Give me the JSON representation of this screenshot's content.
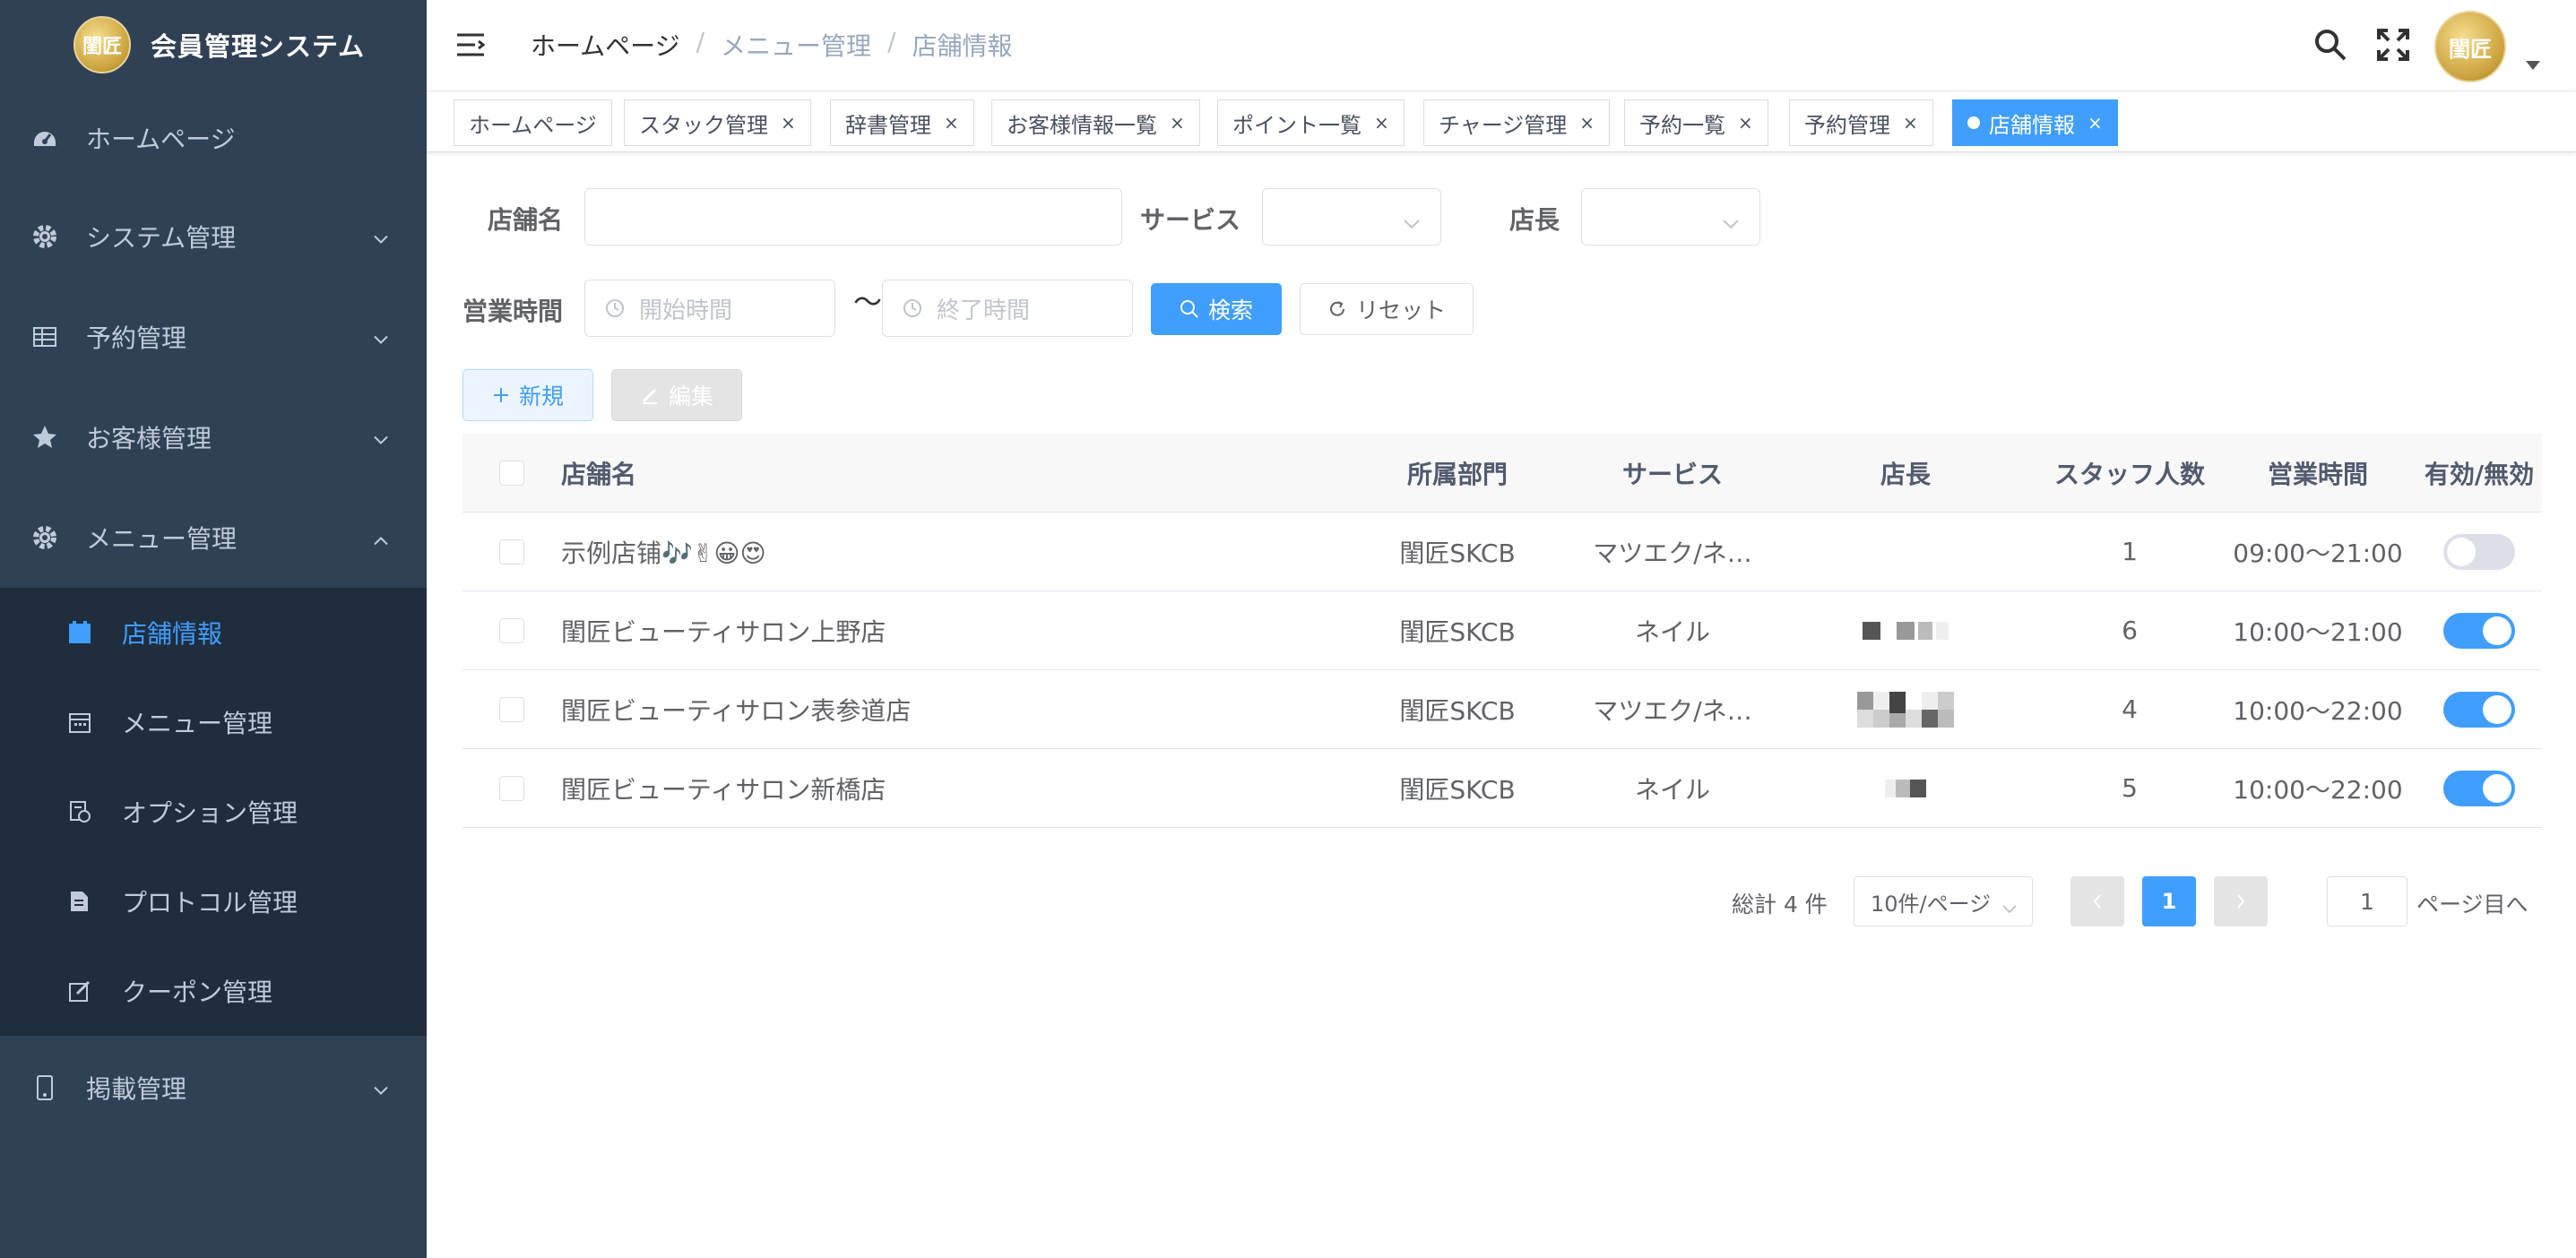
{
  "app": {
    "title": "会員管理システム",
    "logo_text": "閨匠"
  },
  "sidebar": {
    "items": [
      {
        "label": "ホームページ",
        "icon": "dashboard-icon"
      },
      {
        "label": "システム管理",
        "icon": "gear-icon"
      },
      {
        "label": "予約管理",
        "icon": "table-icon"
      },
      {
        "label": "お客様管理",
        "icon": "star-icon"
      },
      {
        "label": "メニュー管理",
        "icon": "gear-icon",
        "expanded": true
      }
    ],
    "submenu": [
      {
        "label": "店舗情報",
        "icon": "shop-icon",
        "active": true
      },
      {
        "label": "メニュー管理",
        "icon": "calendar-icon"
      },
      {
        "label": "オプション管理",
        "icon": "option-icon"
      },
      {
        "label": "プロトコル管理",
        "icon": "document-icon"
      },
      {
        "label": "クーポン管理",
        "icon": "edit-icon"
      }
    ],
    "bottom_item": {
      "label": "掲載管理",
      "icon": "phone-icon"
    }
  },
  "breadcrumb": [
    "ホームページ",
    "メニュー管理",
    "店舗情報"
  ],
  "breadcrumb_sep": "/",
  "tags": [
    {
      "label": "ホームページ",
      "closable": false
    },
    {
      "label": "スタック管理",
      "closable": true
    },
    {
      "label": "辞書管理",
      "closable": true
    },
    {
      "label": "お客様情報一覧",
      "closable": true
    },
    {
      "label": "ポイント一覧",
      "closable": true
    },
    {
      "label": "チャージ管理",
      "closable": true
    },
    {
      "label": "予約一覧",
      "closable": true
    },
    {
      "label": "予約管理",
      "closable": true
    },
    {
      "label": "店舗情報",
      "closable": true,
      "active": true
    }
  ],
  "tag_close": "×",
  "search_form": {
    "store_name_label": "店舗名",
    "store_name_value": "",
    "service_label": "サービス",
    "manager_label": "店長",
    "hours_label": "営業時間",
    "start_placeholder": "開始時間",
    "range_sep": "〜",
    "end_placeholder": "終了時間",
    "search_button": "検索",
    "reset_button": "リセット"
  },
  "toolbar": {
    "new_button": "新規",
    "edit_button": "編集"
  },
  "table": {
    "headers": [
      "店舗名",
      "所属部門",
      "サービス",
      "店長",
      "スタッフ人数",
      "営業時間",
      "有効/無効"
    ],
    "rows": [
      {
        "name": "示例店铺🎶✌😀😍",
        "dept": "閨匠SKCB",
        "service": "マツエク/ネ…",
        "manager": "",
        "staff": "1",
        "hours": "09:00〜21:00",
        "enabled": false
      },
      {
        "name": "閨匠ビューティサロン上野店",
        "dept": "閨匠SKCB",
        "service": "ネイル",
        "manager": "",
        "staff": "6",
        "hours": "10:00〜21:00",
        "enabled": true
      },
      {
        "name": "閨匠ビューティサロン表参道店",
        "dept": "閨匠SKCB",
        "service": "マツエク/ネ…",
        "manager": "",
        "staff": "4",
        "hours": "10:00〜22:00",
        "enabled": true
      },
      {
        "name": "閨匠ビューティサロン新橋店",
        "dept": "閨匠SKCB",
        "service": "ネイル",
        "manager": "",
        "staff": "5",
        "hours": "10:00〜22:00",
        "enabled": true
      }
    ]
  },
  "pagination": {
    "total_text": "総計 4 件",
    "page_size": "10件/ページ",
    "current_page": "1",
    "jump_value": "1",
    "jump_suffix": "ページ目へ"
  },
  "colors": {
    "sidebar_bg": "#304156",
    "submenu_bg": "#1f2d3d",
    "primary": "#409eff",
    "sidebar_text": "#bfcbd9"
  }
}
